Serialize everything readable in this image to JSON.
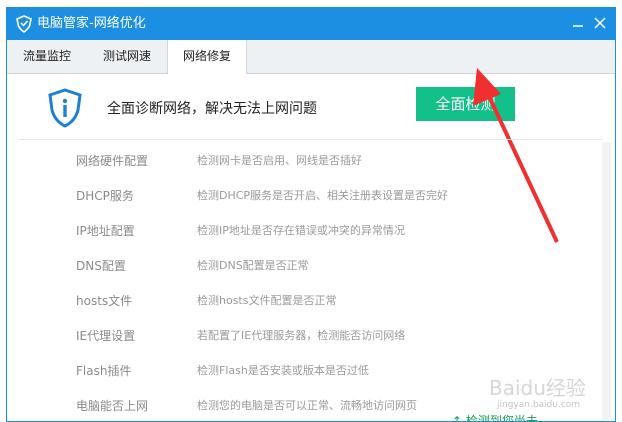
{
  "window": {
    "title": "电脑管家-网络优化"
  },
  "tabs": [
    {
      "label": "流量监控"
    },
    {
      "label": "测试网速"
    },
    {
      "label": "网络修复"
    }
  ],
  "hero": {
    "text": "全面诊断网络，解决无法上网问题",
    "button": "全面检测"
  },
  "items": [
    {
      "name": "网络硬件配置",
      "desc": "检测网卡是否启用、网线是否插好"
    },
    {
      "name": "DHCP服务",
      "desc": "检测DHCP服务是否开启、相关注册表设置是否完好"
    },
    {
      "name": "IP地址配置",
      "desc": "检测IP地址是否存在错误或冲突的异常情况"
    },
    {
      "name": "DNS配置",
      "desc": "检测DNS配置是否正常"
    },
    {
      "name": "hosts文件",
      "desc": "检测hosts文件配置是否正常"
    },
    {
      "name": "IE代理设置",
      "desc": "若配置了IE代理服务器，检测能否访问网络"
    },
    {
      "name": "Flash插件",
      "desc": "检测Flash是否安装或版本是否过低"
    },
    {
      "name": "电脑能否上网",
      "desc": "检测您的电脑是否可以正常、流畅地访问网页"
    }
  ],
  "peek_text": "↑ 检测到您尚未...",
  "watermark": {
    "brand": "Baidu经验",
    "url": "jingyan.baidu.com"
  },
  "colors": {
    "titlebar": "#1d8fe3",
    "button": "#14c08a",
    "arrow": "#f0302e"
  }
}
